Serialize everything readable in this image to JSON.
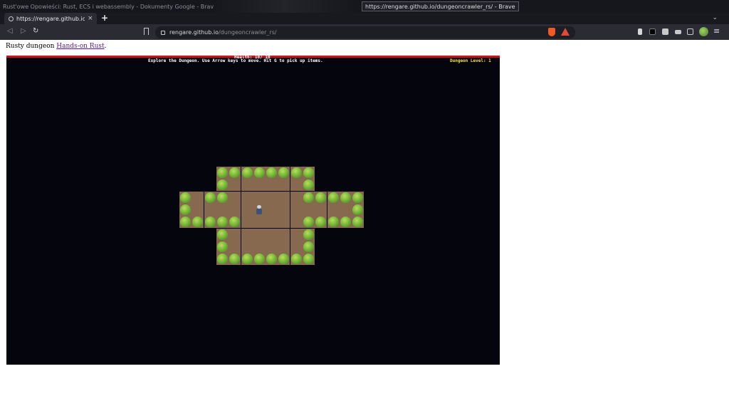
{
  "os": {
    "background_window_title": "Rust'owe Opowieści: Rust, ECS i webassembly - Dokumenty Google - Brave",
    "active_window_title": "https://rengare.github.io/dungeoncrawler_rs/ - Brave"
  },
  "browser": {
    "tab_title": "https://rengare.github.io/d",
    "new_tab_symbol": "+",
    "tab_close_symbol": "×",
    "back_symbol": "◁",
    "forward_symbol": "▷",
    "reload_symbol": "↻",
    "menu_symbol": "≡",
    "tabs_dropdown_symbol": "⌄",
    "url_domain": "rengare.github.io",
    "url_path": "/dungeoncrawler_rs/"
  },
  "page": {
    "intro_text": "Rusty dungeon ",
    "link_text": "Hands-on Rust",
    "intro_suffix": "."
  },
  "game": {
    "health_text": "Health: 10/ 10",
    "instructions": "Explore the Dungeon. Use Arrow keys to move. Hit G to pick up items.",
    "dungeon_level": "Dungeon Level: 1",
    "colors": {
      "health_bar": "#c8141a",
      "floor": "#86694f",
      "tree": "#7cb83a",
      "level_text": "#f4e542"
    }
  }
}
